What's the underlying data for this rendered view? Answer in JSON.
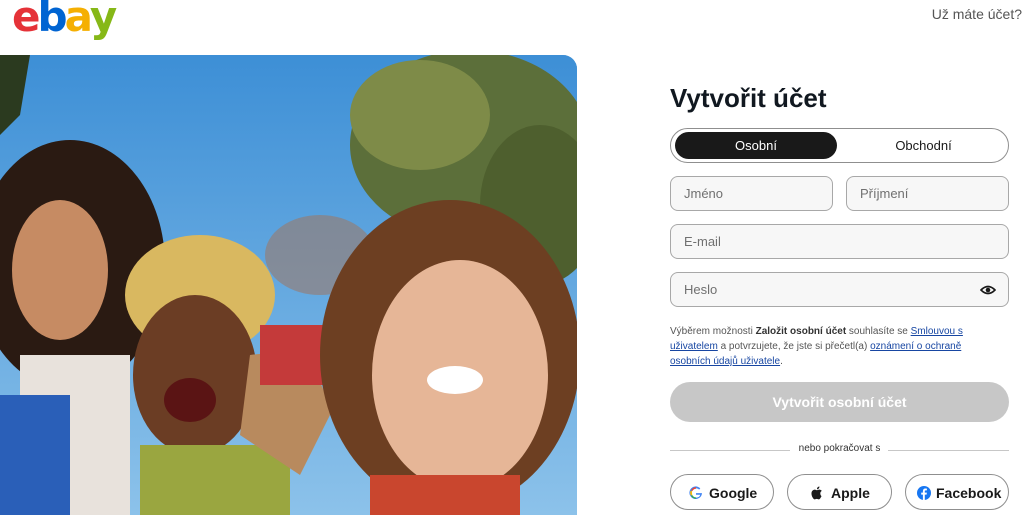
{
  "header": {
    "logo_letters": [
      {
        "char": "e",
        "color": "#e53238"
      },
      {
        "char": "b",
        "color": "#0064d2"
      },
      {
        "char": "a",
        "color": "#f5af02"
      },
      {
        "char": "y",
        "color": "#86b817"
      }
    ],
    "signin_link": "Už máte účet?"
  },
  "form": {
    "title": "Vytvořit účet",
    "account_types": [
      {
        "label": "Osobní",
        "active": true
      },
      {
        "label": "Obchodní",
        "active": false
      }
    ],
    "fields": {
      "first_name_placeholder": "Jméno",
      "last_name_placeholder": "Příjmení",
      "email_placeholder": "E-mail",
      "password_placeholder": "Heslo"
    },
    "legal": {
      "part1": "Výběrem možnosti ",
      "bold": "Založit osobní účet",
      "part2": " souhlasíte se ",
      "link1": "Smlouvou s uživatelem",
      "part3": " a potvrzujete, že jste si přečetl(a) ",
      "link2": "oznámení o ochraně osobních údajů uživatele",
      "part4": "."
    },
    "submit_label": "Vytvořit osobní účet",
    "divider_text": "nebo pokračovat s",
    "social": {
      "google": "Google",
      "apple": "Apple",
      "facebook": "Facebook"
    }
  },
  "colors": {
    "active_segment": "#191919",
    "submit_disabled": "#c7c7c7",
    "link": "#1746a2",
    "facebook": "#1877f2"
  }
}
